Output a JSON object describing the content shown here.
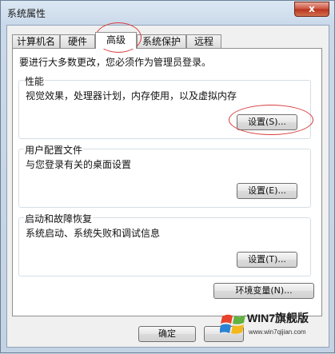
{
  "window": {
    "title": "系统属性",
    "close_label": "x"
  },
  "tabs": [
    {
      "label": "计算机名"
    },
    {
      "label": "硬件"
    },
    {
      "label": "高级"
    },
    {
      "label": "系统保护"
    },
    {
      "label": "远程"
    }
  ],
  "notice": "要进行大多数更改，您必须作为管理员登录。",
  "groups": {
    "performance": {
      "title": "性能",
      "desc": "视觉效果，处理器计划，内存使用，以及虚拟内存",
      "button": "设置(S)..."
    },
    "profiles": {
      "title": "用户配置文件",
      "desc": "与您登录有关的桌面设置",
      "button": "设置(E)..."
    },
    "startup": {
      "title": "启动和故障恢复",
      "desc": "系统启动、系统失败和调试信息",
      "button": "设置(T)..."
    }
  },
  "env_button": "环境变量(N)...",
  "footer": {
    "ok_label": "确定"
  },
  "watermark": {
    "text": "WIN7旗舰版",
    "url": "www.win7qijian.com"
  }
}
